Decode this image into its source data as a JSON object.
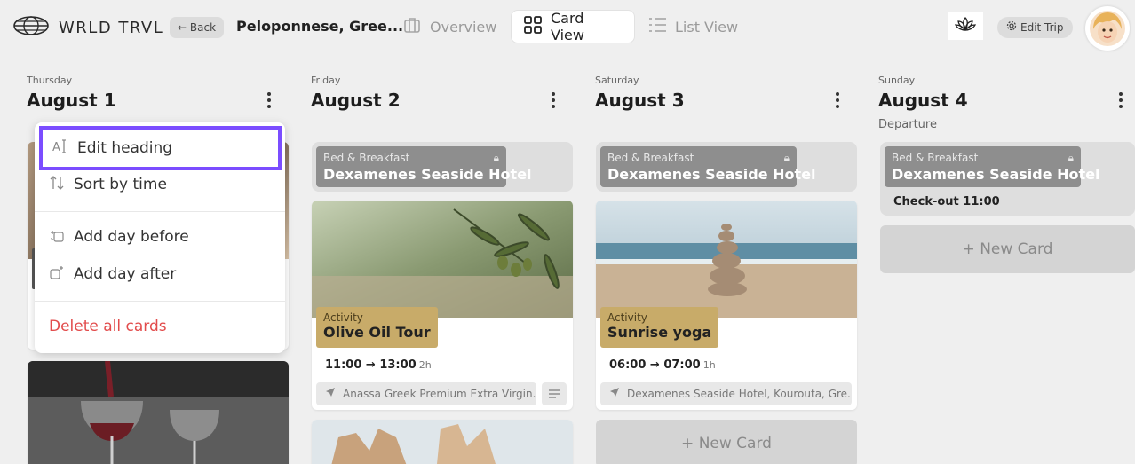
{
  "app": {
    "logo_text": "WRLD TRVL"
  },
  "header": {
    "back_label": "Back",
    "trip_title": "Peloponnese, Gree...",
    "tabs": [
      {
        "label": "Overview",
        "icon": "bag-icon",
        "active": false
      },
      {
        "label": "Card View",
        "icon": "grid-icon",
        "active": true
      },
      {
        "label": "List View",
        "icon": "list-icon",
        "active": false
      }
    ],
    "edit_trip_label": "Edit Trip"
  },
  "days": [
    {
      "weekday": "Thursday",
      "date": "August 1",
      "subtitle": ""
    },
    {
      "weekday": "Friday",
      "date": "August 2",
      "lodging": {
        "category": "Bed & Breakfast",
        "name": "Dexamenes Seaside Hotel"
      },
      "activity": {
        "category": "Activity",
        "name": "Olive Oil Tour",
        "time": "11:00 → 13:00",
        "duration": "2h",
        "location": "Anassa Greek Premium Extra Virgin..."
      }
    },
    {
      "weekday": "Saturday",
      "date": "August 3",
      "lodging": {
        "category": "Bed & Breakfast",
        "name": "Dexamenes Seaside Hotel"
      },
      "activity": {
        "category": "Activity",
        "name": "Sunrise yoga",
        "time": "06:00 → 07:00",
        "duration": "1h",
        "location": "Dexamenes Seaside Hotel, Kourouta, Gre..."
      },
      "new_card_label": "+ New Card"
    },
    {
      "weekday": "Sunday",
      "date": "August 4",
      "subtitle": "Departure",
      "lodging": {
        "category": "Bed & Breakfast",
        "name": "Dexamenes Seaside Hotel",
        "note": "Check-out 11:00"
      },
      "new_card_label": "+ New Card"
    }
  ],
  "context_menu": {
    "items": [
      {
        "label": "Edit heading",
        "icon": "text-cursor-icon"
      },
      {
        "label": "Sort by time",
        "icon": "sort-icon"
      },
      {
        "label": "Add day before",
        "icon": "add-day-before-icon"
      },
      {
        "label": "Add day after",
        "icon": "add-day-after-icon"
      },
      {
        "label": "Delete all cards",
        "icon": ""
      }
    ]
  },
  "colors": {
    "accent_purple": "#7b4dff",
    "activity_tag": "#c8ab69",
    "lodging_tag": "#8e8e8e",
    "danger": "#e24c4c"
  }
}
